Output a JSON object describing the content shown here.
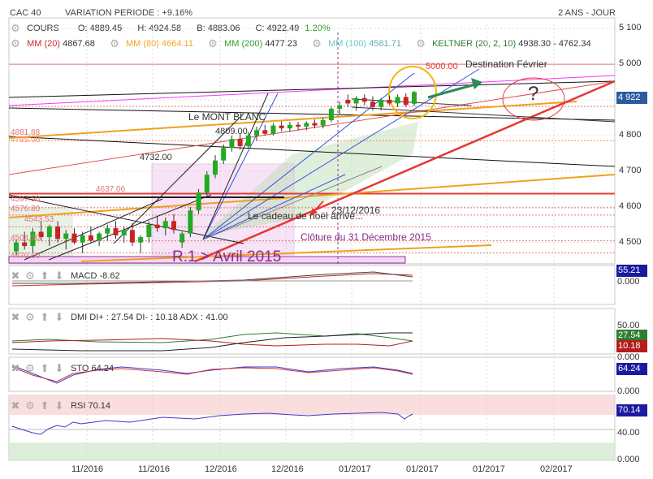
{
  "header": {
    "symbol": "CAC 40",
    "variation": "VARIATION PERIODE : +9.16%",
    "range": "2 ANS - JOUR"
  },
  "price_legend": {
    "cours_label": "COURS",
    "open": "O: 4889.45",
    "high": "H: 4924.58",
    "low": "B: 4883.06",
    "close": "C: 4922.49",
    "change": "1.20%"
  },
  "ma_legend": {
    "mm20": "MM (20)",
    "mm20_val": "4867.68",
    "mm80": "MM (80)",
    "mm80_val": "4664.11",
    "mm200": "MM (200)",
    "mm200_val": "4477.23",
    "mm100": "MM (100)",
    "mm100_val": "4581.71",
    "keltner": "KELTNER (20, 2, 10)",
    "keltner_val": "4938.30 - 4762.34"
  },
  "colors": {
    "mm20": "#d62728",
    "mm80": "#f5a623",
    "mm200": "#2ca02c",
    "mm100": "#66cccc",
    "keltner": "#2e7d32",
    "candle_up": "#22aa22",
    "candle_down": "#cc2222",
    "last_price_tag": "#2d5aa0",
    "macd_tag": "#1a1aa0",
    "dmi_plus": "#2e7d32",
    "dmi_minus": "#b71c1c"
  },
  "annotations": {
    "mont_blanc": "Le MONT BLANC",
    "level_4809": "4809.00",
    "level_4732": "4732.00",
    "level_5000": "5000.00",
    "destination": "Destination Février",
    "question": "?",
    "cadeau": "Le cadeau de noël arrive...",
    "date_2312": "23/12/2016",
    "cloture": "Clôture du 31 Décembre 2015",
    "r1": "R.1 > Avril 2015",
    "left_levels": [
      "4881.88",
      "4785.00",
      "4637.06",
      "4597.50",
      "4576.80",
      "4543.53",
      "4504.50",
      "4470.60"
    ]
  },
  "price_axis": {
    "ticks": [
      "5 100",
      "5 000",
      "4 900",
      "4 800",
      "4 700",
      "4 600",
      "4 500"
    ],
    "last_price": "4 922"
  },
  "indicators": {
    "macd_label": "MACD",
    "macd_value": "-8.62",
    "macd_tag": "55.21",
    "macd_zero": "0.000",
    "dmi_label": "DMI",
    "dmi_text": "DI+ : 27.54 DI- : 10.18 ADX : 41.00",
    "dmi_axis_top": "50.00",
    "dmi_plus_tag": "27.54",
    "dmi_minus_tag": "10.18",
    "dmi_zero": "0.000",
    "sto_label": "STO",
    "sto_value": "64.24",
    "sto_tag": "64.24",
    "sto_zero": "0.000",
    "rsi_label": "RSI",
    "rsi_value": "70.14",
    "rsi_tag": "70.14",
    "rsi_mid": "40.00",
    "rsi_zero": "0.000"
  },
  "x_axis": {
    "labels": [
      "11/2016",
      "11/2016",
      "12/2016",
      "12/2016",
      "01/2017",
      "01/2017",
      "01/2017",
      "02/2017"
    ]
  },
  "chart_data": {
    "type": "candlestick",
    "title": "CAC 40",
    "ylim": [
      4440,
      5130
    ],
    "candles": [
      {
        "o": 4475,
        "h": 4510,
        "l": 4460,
        "c": 4500
      },
      {
        "o": 4500,
        "h": 4530,
        "l": 4480,
        "c": 4490
      },
      {
        "o": 4490,
        "h": 4540,
        "l": 4470,
        "c": 4530
      },
      {
        "o": 4530,
        "h": 4560,
        "l": 4505,
        "c": 4515
      },
      {
        "o": 4515,
        "h": 4550,
        "l": 4490,
        "c": 4545
      },
      {
        "o": 4545,
        "h": 4560,
        "l": 4500,
        "c": 4510
      },
      {
        "o": 4510,
        "h": 4535,
        "l": 4480,
        "c": 4525
      },
      {
        "o": 4525,
        "h": 4540,
        "l": 4495,
        "c": 4500
      },
      {
        "o": 4500,
        "h": 4530,
        "l": 4470,
        "c": 4520
      },
      {
        "o": 4520,
        "h": 4545,
        "l": 4500,
        "c": 4505
      },
      {
        "o": 4505,
        "h": 4530,
        "l": 4490,
        "c": 4525
      },
      {
        "o": 4525,
        "h": 4550,
        "l": 4505,
        "c": 4540
      },
      {
        "o": 4540,
        "h": 4560,
        "l": 4510,
        "c": 4520
      },
      {
        "o": 4520,
        "h": 4545,
        "l": 4500,
        "c": 4535
      },
      {
        "o": 4535,
        "h": 4555,
        "l": 4490,
        "c": 4500
      },
      {
        "o": 4500,
        "h": 4520,
        "l": 4470,
        "c": 4515
      },
      {
        "o": 4515,
        "h": 4560,
        "l": 4500,
        "c": 4550
      },
      {
        "o": 4550,
        "h": 4575,
        "l": 4530,
        "c": 4540
      },
      {
        "o": 4540,
        "h": 4570,
        "l": 4520,
        "c": 4560
      },
      {
        "o": 4560,
        "h": 4580,
        "l": 4525,
        "c": 4535
      },
      {
        "o": 4500,
        "h": 4530,
        "l": 4485,
        "c": 4525
      },
      {
        "o": 4525,
        "h": 4600,
        "l": 4515,
        "c": 4590
      },
      {
        "o": 4590,
        "h": 4650,
        "l": 4580,
        "c": 4640
      },
      {
        "o": 4640,
        "h": 4700,
        "l": 4630,
        "c": 4690
      },
      {
        "o": 4690,
        "h": 4745,
        "l": 4680,
        "c": 4730
      },
      {
        "o": 4730,
        "h": 4775,
        "l": 4720,
        "c": 4765
      },
      {
        "o": 4765,
        "h": 4800,
        "l": 4755,
        "c": 4790
      },
      {
        "o": 4790,
        "h": 4805,
        "l": 4760,
        "c": 4770
      },
      {
        "o": 4770,
        "h": 4810,
        "l": 4765,
        "c": 4800
      },
      {
        "o": 4800,
        "h": 4825,
        "l": 4785,
        "c": 4815
      },
      {
        "o": 4815,
        "h": 4830,
        "l": 4800,
        "c": 4805
      },
      {
        "o": 4805,
        "h": 4835,
        "l": 4800,
        "c": 4828
      },
      {
        "o": 4828,
        "h": 4840,
        "l": 4812,
        "c": 4820
      },
      {
        "o": 4820,
        "h": 4838,
        "l": 4810,
        "c": 4830
      },
      {
        "o": 4830,
        "h": 4838,
        "l": 4815,
        "c": 4825
      },
      {
        "o": 4825,
        "h": 4840,
        "l": 4815,
        "c": 4835
      },
      {
        "o": 4835,
        "h": 4845,
        "l": 4820,
        "c": 4828
      },
      {
        "o": 4828,
        "h": 4850,
        "l": 4820,
        "c": 4843
      },
      {
        "o": 4843,
        "h": 4880,
        "l": 4838,
        "c": 4875
      },
      {
        "o": 4875,
        "h": 4895,
        "l": 4860,
        "c": 4885
      },
      {
        "o": 4900,
        "h": 4915,
        "l": 4880,
        "c": 4890
      },
      {
        "o": 4890,
        "h": 4910,
        "l": 4870,
        "c": 4905
      },
      {
        "o": 4905,
        "h": 4915,
        "l": 4885,
        "c": 4895
      },
      {
        "o": 4895,
        "h": 4910,
        "l": 4870,
        "c": 4880
      },
      {
        "o": 4880,
        "h": 4905,
        "l": 4870,
        "c": 4900
      },
      {
        "o": 4900,
        "h": 4912,
        "l": 4885,
        "c": 4890
      },
      {
        "o": 4890,
        "h": 4915,
        "l": 4880,
        "c": 4908
      },
      {
        "o": 4908,
        "h": 4918,
        "l": 4880,
        "c": 4886
      },
      {
        "o": 4889,
        "h": 4925,
        "l": 4883,
        "c": 4922
      }
    ],
    "hlines": [
      {
        "value": 5000,
        "color": "#e57373"
      },
      {
        "value": 4881.88,
        "color": "#e57373"
      },
      {
        "value": 4785,
        "color": "#ff8a65"
      },
      {
        "value": 4637.06,
        "color": "#e53935"
      },
      {
        "value": 4597.5,
        "color": "#e57373"
      },
      {
        "value": 4576.8,
        "color": "#e57373"
      },
      {
        "value": 4543.53,
        "color": "#e57373"
      },
      {
        "value": 4504.5,
        "color": "#e57373"
      },
      {
        "value": 4470.6,
        "color": "#e57373"
      }
    ],
    "y_ticks": [
      5100,
      5000,
      4900,
      4800,
      4700,
      4600,
      4500
    ]
  }
}
